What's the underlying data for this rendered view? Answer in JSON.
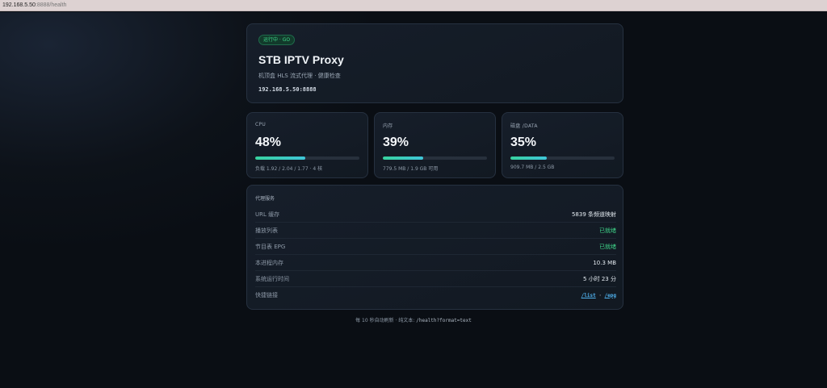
{
  "browser": {
    "url_host": "192.168.5.50",
    "url_rest": ":8888/health"
  },
  "hero": {
    "badge": "运行中 · GO",
    "title": "STB IPTV Proxy",
    "subtitle": "机顶盒 HLS 流式代理 · 健康检查",
    "address": "192.168.5.50:8888"
  },
  "stats": [
    {
      "label": "CPU",
      "value": "48%",
      "percent": 48,
      "detail": "负载 1.92 / 2.04 / 1.77 · 4 核"
    },
    {
      "label": "内存",
      "value": "39%",
      "percent": 39,
      "detail": "779.5 MB / 1.9 GB 可用"
    },
    {
      "label": "磁盘 /DATA",
      "value": "35%",
      "percent": 35,
      "detail": "909.7 MB / 2.5 GB"
    }
  ],
  "service": {
    "title": "代理服务",
    "rows": [
      {
        "key": "URL 缓存",
        "value": "5839 条频道映射"
      },
      {
        "key": "播放列表",
        "value": "已就绪"
      },
      {
        "key": "节目表 EPG",
        "value": "已就绪"
      },
      {
        "key": "本进程内存",
        "value": "10.3 MB"
      },
      {
        "key": "系统运行时间",
        "value": "5 小时 23 分"
      },
      {
        "key": "快捷链接",
        "link1": "/list",
        "sep": " · ",
        "link2": "/epg"
      }
    ]
  },
  "footer": {
    "text": "每 10 秒自动刷新 · 纯文本: ",
    "code": "/health?format=text"
  },
  "colors": {
    "accent_green": "#3fd68a",
    "link_blue": "#4fb3f0",
    "background": "#0a0e14"
  }
}
